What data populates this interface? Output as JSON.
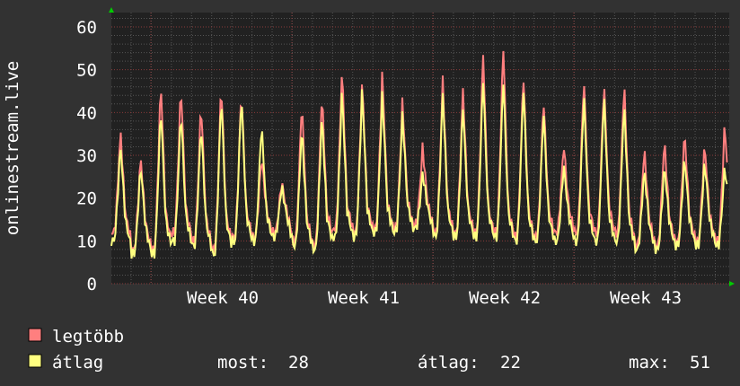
{
  "chart_data": {
    "type": "line",
    "ylabel": "onlinestream.live",
    "ylim": [
      0,
      60
    ],
    "yticks": [
      0,
      10,
      20,
      30,
      40,
      50,
      60
    ],
    "xtick_labels": [
      "Week 40",
      "Week 41",
      "Week 42",
      "Week 43"
    ],
    "grid": true,
    "legend_placement": "bottom-left",
    "days": 31,
    "series": [
      {
        "name": "legtöbb",
        "color": "#ff7f7f",
        "daily_peaks": [
          36,
          30,
          48,
          47,
          43,
          48,
          46,
          30,
          24,
          43,
          45,
          51,
          48,
          50,
          43,
          32,
          48,
          46,
          55,
          57,
          50,
          44,
          33,
          49,
          48,
          48,
          32,
          34,
          36,
          33,
          38
        ],
        "daily_lows": [
          12,
          8,
          8,
          12,
          10,
          8,
          11,
          11,
          12,
          10,
          9,
          13,
          12,
          13,
          13,
          14,
          12,
          12,
          12,
          12,
          11,
          11,
          12,
          12,
          12,
          12,
          9,
          9,
          10,
          10,
          10
        ]
      },
      {
        "name": "átlag",
        "color": "#ffff80",
        "daily_peaks": [
          33,
          28,
          42,
          41,
          38,
          45,
          45,
          38,
          23,
          37,
          40,
          46,
          46,
          45,
          40,
          26,
          45,
          42,
          49,
          49,
          47,
          41,
          28,
          45,
          45,
          43,
          27,
          28,
          30,
          29,
          28
        ],
        "daily_lows": [
          10,
          7,
          7,
          10,
          9,
          7,
          10,
          10,
          11,
          9,
          8,
          11,
          11,
          12,
          12,
          13,
          11,
          11,
          11,
          11,
          10,
          10,
          10,
          10,
          10,
          10,
          8,
          8,
          9,
          9,
          9
        ]
      }
    ],
    "stats": {
      "now_label": "most:",
      "now_value": "28",
      "avg_label": "átlag:",
      "avg_value": "22",
      "max_label": "max:",
      "max_value": "51"
    }
  }
}
